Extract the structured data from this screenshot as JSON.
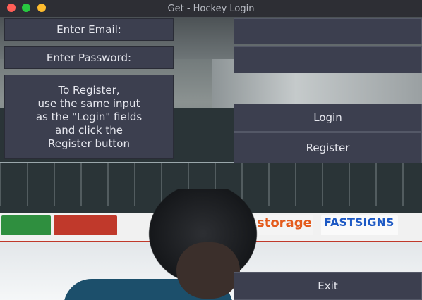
{
  "window": {
    "title": "Get - Hockey Login"
  },
  "form": {
    "email_label": "Enter Email:",
    "password_label": "Enter Password:",
    "email_value": "",
    "password_value": "",
    "register_info": "To Register,\nuse the same input\nas the \"Login\" fields\nand click the\nRegister button",
    "login_button": "Login",
    "register_button": "Register",
    "exit_button": "Exit"
  },
  "background_ads": [
    "storage",
    "FASTSIGNS"
  ],
  "colors": {
    "panel": "#3c3f4f",
    "text": "#e6e7ee"
  }
}
